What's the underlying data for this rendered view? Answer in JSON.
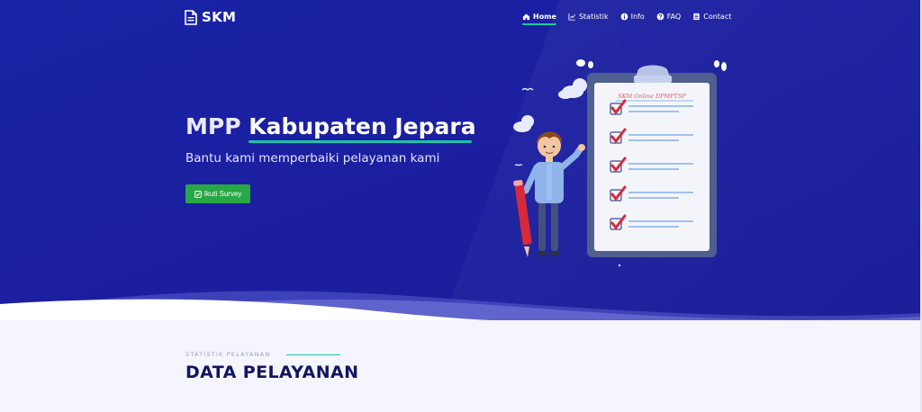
{
  "brand": {
    "name": "SKM",
    "icon": "document-icon"
  },
  "nav": {
    "items": [
      {
        "label": "Home",
        "icon": "home-icon",
        "active": true
      },
      {
        "label": "Statistik",
        "icon": "chart-icon",
        "active": false
      },
      {
        "label": "Info",
        "icon": "info-icon",
        "active": false
      },
      {
        "label": "FAQ",
        "icon": "question-icon",
        "active": false
      },
      {
        "label": "Contact",
        "icon": "contact-icon",
        "active": false
      }
    ]
  },
  "hero": {
    "title_prefix": "MPP",
    "title_place": "Kabupaten Jepara",
    "subtitle": "Bantu kami memperbaiki pelayanan kami",
    "button_label": "Ikuti Survey",
    "button_icon": "check-square-icon",
    "clipboard_heading": "SKM Online DPMPTSP"
  },
  "section": {
    "eyebrow": "STATISTIK PELAYANAN",
    "title": "DATA PELAYANAN"
  },
  "colors": {
    "hero_bg": "#1a21a3",
    "accent": "#18c6a8",
    "button": "#28a745",
    "section_title": "#12155e"
  }
}
